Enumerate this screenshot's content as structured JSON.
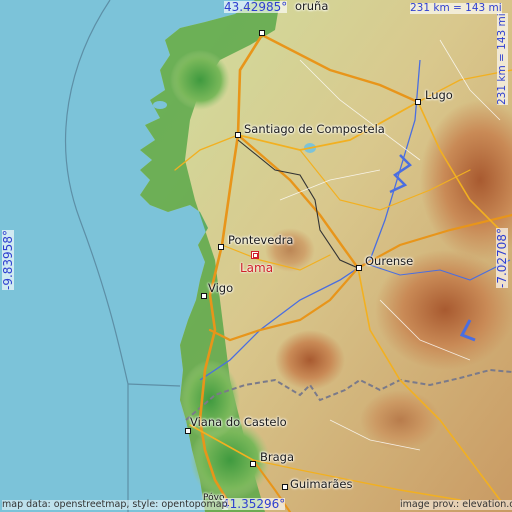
{
  "map": {
    "colors": {
      "sea": "#7cc3d9",
      "lowland": "#5aa84a",
      "upland": "#d8c48a",
      "mountain": "#b86a3a",
      "road": "#f2b020",
      "highway": "#e8951a",
      "river": "#4a6ee0",
      "border": "#7a7a8a"
    }
  },
  "coords": {
    "top_lat": "43.42985°",
    "bottom_lat": "41.35296°",
    "left_lon": "-9.83958°",
    "right_lon": "-7.02708°"
  },
  "scale": {
    "top": "231 km = 143 mi",
    "right": "231 km = 143 mi"
  },
  "place": {
    "name": "Lama"
  },
  "cities": [
    {
      "key": "corunna",
      "label": "oruña"
    },
    {
      "key": "lugo",
      "label": "Lugo"
    },
    {
      "key": "santiago",
      "label": "Santiago de Compostela"
    },
    {
      "key": "pontevedra",
      "label": "Pontevedra"
    },
    {
      "key": "ourense",
      "label": "Ourense"
    },
    {
      "key": "vigo",
      "label": "Vigo"
    },
    {
      "key": "viana",
      "label": "Viana do Castelo"
    },
    {
      "key": "braga",
      "label": "Braga"
    },
    {
      "key": "guimaraes",
      "label": "Guimarães"
    },
    {
      "key": "povoa",
      "label": "Póvo"
    }
  ],
  "attribution": {
    "left": "map data: openstreetmap, style: opentopomap",
    "right": "image prov.: elevation.city"
  }
}
